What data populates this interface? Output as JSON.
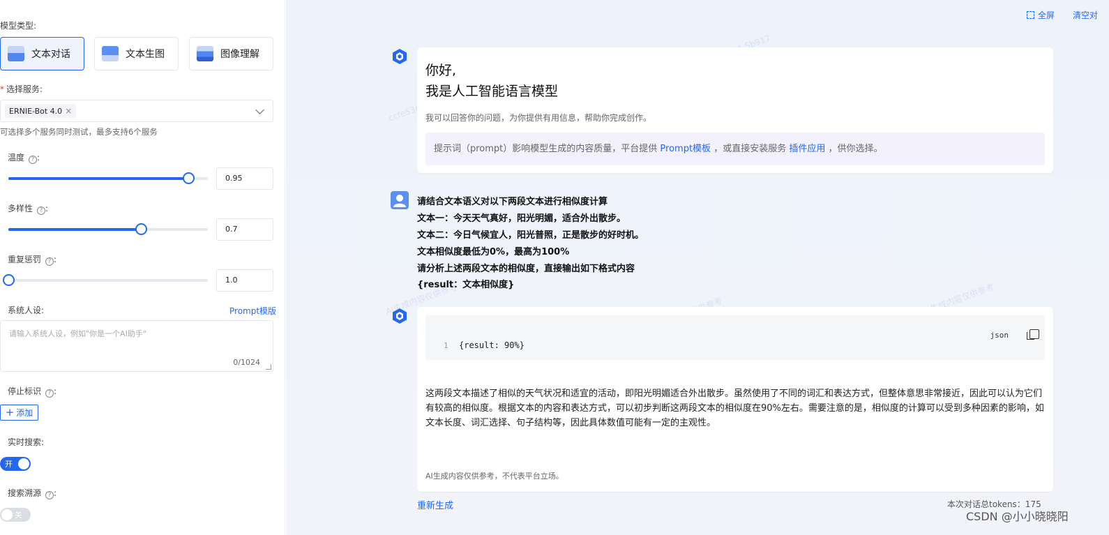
{
  "left": {
    "model_type_label": "模型类型:",
    "model_types": [
      {
        "label": "文本对话",
        "active": true
      },
      {
        "label": "文本生图",
        "active": false
      },
      {
        "label": "图像理解",
        "active": false
      }
    ],
    "service_required": "*",
    "service_label": "选择服务:",
    "service_tag": "ERNIE-Bot 4.0",
    "service_hint": "可选择多个服务同时测试，最多支持6个服务",
    "temperature_label": "温度",
    "temperature_value": "0.95",
    "temperature_fraction": 0.95,
    "diversity_label": "多样性",
    "diversity_value": "0.7",
    "diversity_fraction": 0.7,
    "penalty_label": "重复惩罚",
    "penalty_value": "1.0",
    "penalty_fraction": 0.0,
    "system_label": "系统人设:",
    "prompt_template_link": "Prompt模版",
    "system_placeholder": "请输入系统人设，例如\"你是一个AI助手\"",
    "system_count": "0/1024",
    "stop_label": "停止标识",
    "add_label": "添加",
    "realtime_label": "实时搜索:",
    "realtime_toggle": "开",
    "search_source_label": "搜索溯源",
    "search_source_toggle": "关"
  },
  "topbar": {
    "fullscreen": "全屏",
    "clear": "清空对"
  },
  "chat": {
    "welcome_line1": "你好,",
    "welcome_line2": "我是人工智能语言模型",
    "welcome_sub": "我可以回答你的问题，为你提供有用信息，帮助你完成创作。",
    "hint_pre": "提示词（prompt）影响模型生成的内容质量，平台提供",
    "hint_link1": "Prompt模板",
    "hint_mid": "，或直接安装服务",
    "hint_link2": "插件应用",
    "hint_post": "，供你选择。",
    "user_lines": [
      "请结合文本语义对以下两段文本进行相似度计算",
      "文本一：今天天气真好，阳光明媚，适合外出散步。",
      "文本二：今日气候宜人，阳光普照，正是散步的好时机。",
      "文本相似度最低为0%，最高为100%",
      "请分析上述两段文本的相似度，直接输出如下格式内容",
      "{result：文本相似度}"
    ],
    "code_line_no": "1",
    "code_text": "{result: 90%}",
    "code_lang": "json",
    "answer": "这两段文本描述了相似的天气状况和适宜的活动，即阳光明媚适合外出散步。虽然使用了不同的词汇和表达方式，但整体意思非常接近，因此可以认为它们有较高的相似度。根据文本的内容和表达方式，可以初步判断这两段文本的相似度在90%左右。需要注意的是，相似度的计算可以受到多种因素的影响，如文本长度、词汇选择、句子结构等，因此具体数值可能有一定的主观性。",
    "disclaimer": "AI生成内容仅供参考，不代表平台立场。",
    "regenerate": "重新生成",
    "tokens": "本次对话总tokens：175"
  },
  "watermark_corner": "CSDN @小小晓晓阳",
  "watermark_bg_1": "ccfe53dbbd95d04bl0c1817ae3981 5b917",
  "watermark_bg_2": "AI生成内容仅供参考"
}
